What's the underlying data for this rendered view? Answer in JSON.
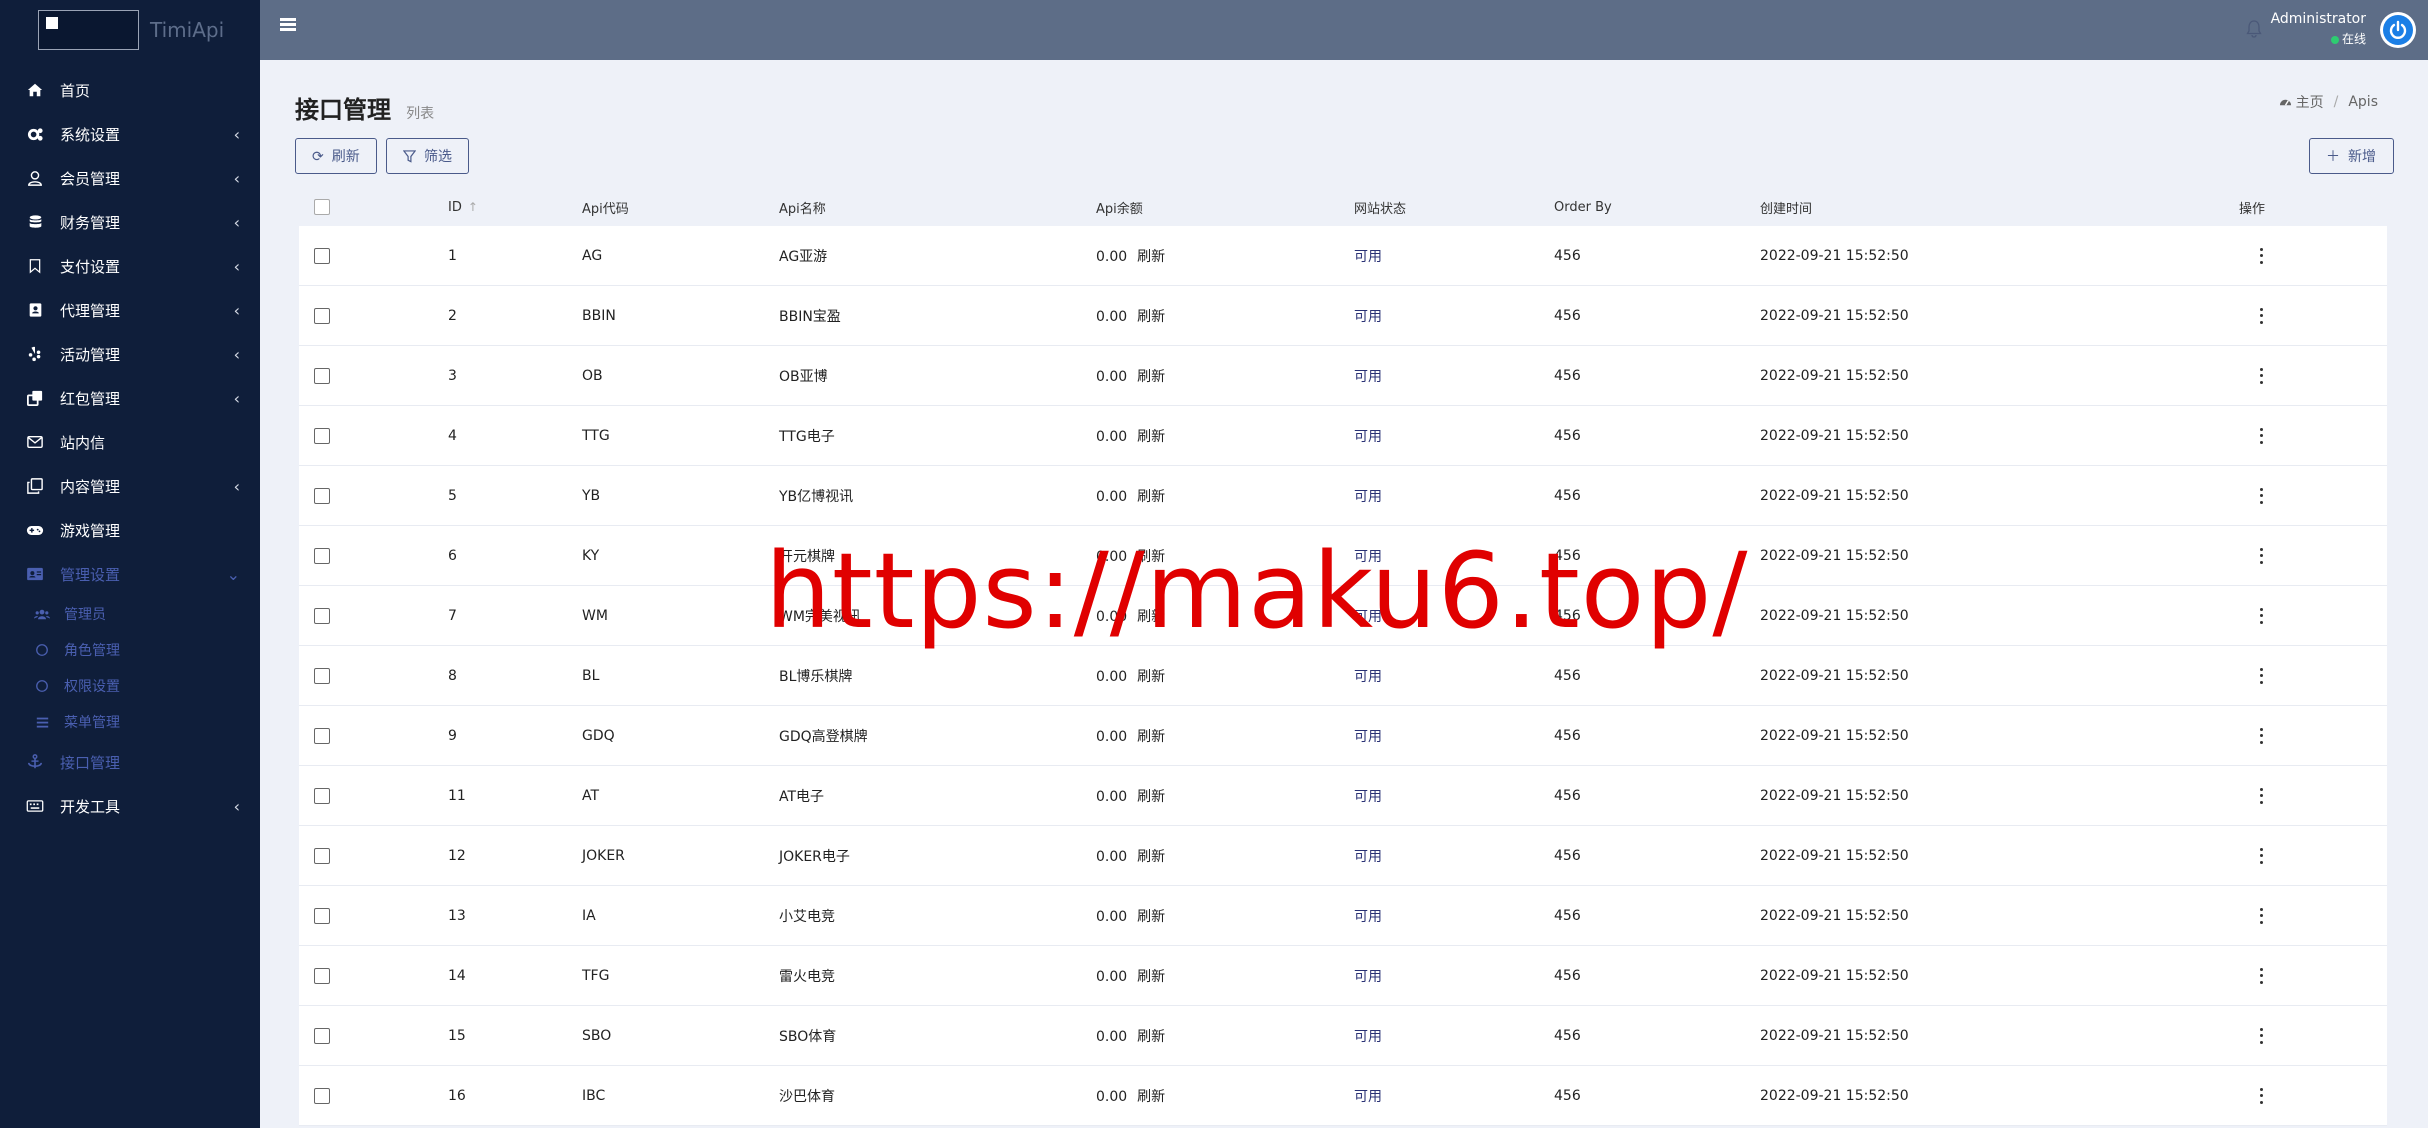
{
  "brand": {
    "name": "TimiApi"
  },
  "sidebar": {
    "items": [
      {
        "label": "首页",
        "icon": "home-icon",
        "arrow": ""
      },
      {
        "label": "系统设置",
        "icon": "cogs-icon",
        "arrow": "‹"
      },
      {
        "label": "会员管理",
        "icon": "user-icon",
        "arrow": "‹"
      },
      {
        "label": "财务管理",
        "icon": "database-icon",
        "arrow": "‹"
      },
      {
        "label": "支付设置",
        "icon": "bookmark-icon",
        "arrow": "‹"
      },
      {
        "label": "代理管理",
        "icon": "address-book-icon",
        "arrow": "‹"
      },
      {
        "label": "活动管理",
        "icon": "yelp-icon",
        "arrow": "‹"
      },
      {
        "label": "红包管理",
        "icon": "clone-icon",
        "arrow": "‹"
      },
      {
        "label": "站内信",
        "icon": "envelope-icon",
        "arrow": ""
      },
      {
        "label": "内容管理",
        "icon": "copy-icon",
        "arrow": "‹"
      },
      {
        "label": "游戏管理",
        "icon": "gamepad-icon",
        "arrow": ""
      },
      {
        "label": "管理设置",
        "icon": "id-card-icon",
        "arrow": "⌄"
      }
    ],
    "sub_items": [
      {
        "label": "管理员",
        "icon": "users-icon"
      },
      {
        "label": "角色管理",
        "icon": "circle-icon"
      },
      {
        "label": "权限设置",
        "icon": "circle-icon"
      },
      {
        "label": "菜单管理",
        "icon": "list-icon"
      }
    ],
    "after": [
      {
        "label": "接口管理",
        "icon": "anchor-icon",
        "arrow": ""
      },
      {
        "label": "开发工具",
        "icon": "keyboard-icon",
        "arrow": "‹"
      }
    ]
  },
  "header": {
    "user_name": "Administrator",
    "status": "在线"
  },
  "page": {
    "title": "接口管理",
    "subtitle": "列表",
    "breadcrumb_home": "主页",
    "breadcrumb_current": "Apis",
    "breadcrumb_sep": "/"
  },
  "toolbar": {
    "refresh_label": "刷新",
    "filter_label": "筛选",
    "add_label": "新增"
  },
  "table": {
    "headers": {
      "id": "ID",
      "code": "Api代码",
      "name": "Api名称",
      "balance": "Api余额",
      "status": "网站状态",
      "order": "Order By",
      "time": "创建时间",
      "op": "操作"
    },
    "refresh_text": "刷新",
    "rows": [
      {
        "id": "1",
        "code": "AG",
        "name": "AG亚游",
        "balance": "0.00",
        "status": "可用",
        "order": "456",
        "time": "2022-09-21 15:52:50"
      },
      {
        "id": "2",
        "code": "BBIN",
        "name": "BBIN宝盈",
        "balance": "0.00",
        "status": "可用",
        "order": "456",
        "time": "2022-09-21 15:52:50"
      },
      {
        "id": "3",
        "code": "OB",
        "name": "OB亚博",
        "balance": "0.00",
        "status": "可用",
        "order": "456",
        "time": "2022-09-21 15:52:50"
      },
      {
        "id": "4",
        "code": "TTG",
        "name": "TTG电子",
        "balance": "0.00",
        "status": "可用",
        "order": "456",
        "time": "2022-09-21 15:52:50"
      },
      {
        "id": "5",
        "code": "YB",
        "name": "YB亿博视讯",
        "balance": "0.00",
        "status": "可用",
        "order": "456",
        "time": "2022-09-21 15:52:50"
      },
      {
        "id": "6",
        "code": "KY",
        "name": "开元棋牌",
        "balance": "0.00",
        "status": "可用",
        "order": "456",
        "time": "2022-09-21 15:52:50"
      },
      {
        "id": "7",
        "code": "WM",
        "name": "WM完美视讯",
        "balance": "0.00",
        "status": "可用",
        "order": "456",
        "time": "2022-09-21 15:52:50"
      },
      {
        "id": "8",
        "code": "BL",
        "name": "BL博乐棋牌",
        "balance": "0.00",
        "status": "可用",
        "order": "456",
        "time": "2022-09-21 15:52:50"
      },
      {
        "id": "9",
        "code": "GDQ",
        "name": "GDQ高登棋牌",
        "balance": "0.00",
        "status": "可用",
        "order": "456",
        "time": "2022-09-21 15:52:50"
      },
      {
        "id": "11",
        "code": "AT",
        "name": "AT电子",
        "balance": "0.00",
        "status": "可用",
        "order": "456",
        "time": "2022-09-21 15:52:50"
      },
      {
        "id": "12",
        "code": "JOKER",
        "name": "JOKER电子",
        "balance": "0.00",
        "status": "可用",
        "order": "456",
        "time": "2022-09-21 15:52:50"
      },
      {
        "id": "13",
        "code": "IA",
        "name": "小艾电竞",
        "balance": "0.00",
        "status": "可用",
        "order": "456",
        "time": "2022-09-21 15:52:50"
      },
      {
        "id": "14",
        "code": "TFG",
        "name": "雷火电竞",
        "balance": "0.00",
        "status": "可用",
        "order": "456",
        "time": "2022-09-21 15:52:50"
      },
      {
        "id": "15",
        "code": "SBO",
        "name": "SBO体育",
        "balance": "0.00",
        "status": "可用",
        "order": "456",
        "time": "2022-09-21 15:52:50"
      },
      {
        "id": "16",
        "code": "IBC",
        "name": "沙巴体育",
        "balance": "0.00",
        "status": "可用",
        "order": "456",
        "time": "2022-09-21 15:52:50"
      }
    ]
  },
  "watermark": {
    "text": "https://maku6.top/"
  },
  "colors": {
    "sidebar_bg": "#0f1e3a",
    "header_bg": "#5d6d87",
    "active_menu": "#4a5fb0",
    "status_text": "#2a3275",
    "online_dot": "#2ecc71",
    "watermark": "#e00000"
  }
}
